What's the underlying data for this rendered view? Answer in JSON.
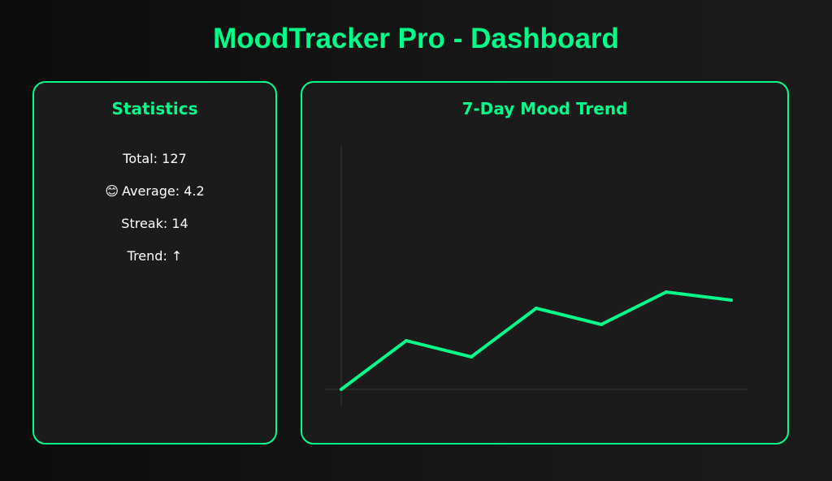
{
  "app": {
    "title": "MoodTracker Pro - Dashboard"
  },
  "statistics": {
    "title": "Statistics",
    "total": "Total: 127",
    "average_icon": "smiling-face-icon",
    "average_emoji": "😊",
    "average": "Average: 4.2",
    "streak": "Streak: 14",
    "trend": "Trend: ↑"
  },
  "chart_panel": {
    "title": "7-Day Mood Trend"
  },
  "colors": {
    "accent": "#00ff88",
    "background": "#121212",
    "panel": "#1b1b1b",
    "axis": "#2e2e2e"
  },
  "chart_data": {
    "type": "line",
    "title": "7-Day Mood Trend",
    "xlabel": "",
    "ylabel": "",
    "x": [
      1,
      2,
      3,
      4,
      5,
      6,
      7
    ],
    "series": [
      {
        "values": [
          0,
          3,
          2,
          5,
          4,
          6,
          5.5
        ]
      }
    ],
    "ylim": [
      0,
      15
    ],
    "grid": false,
    "legend": "none"
  }
}
